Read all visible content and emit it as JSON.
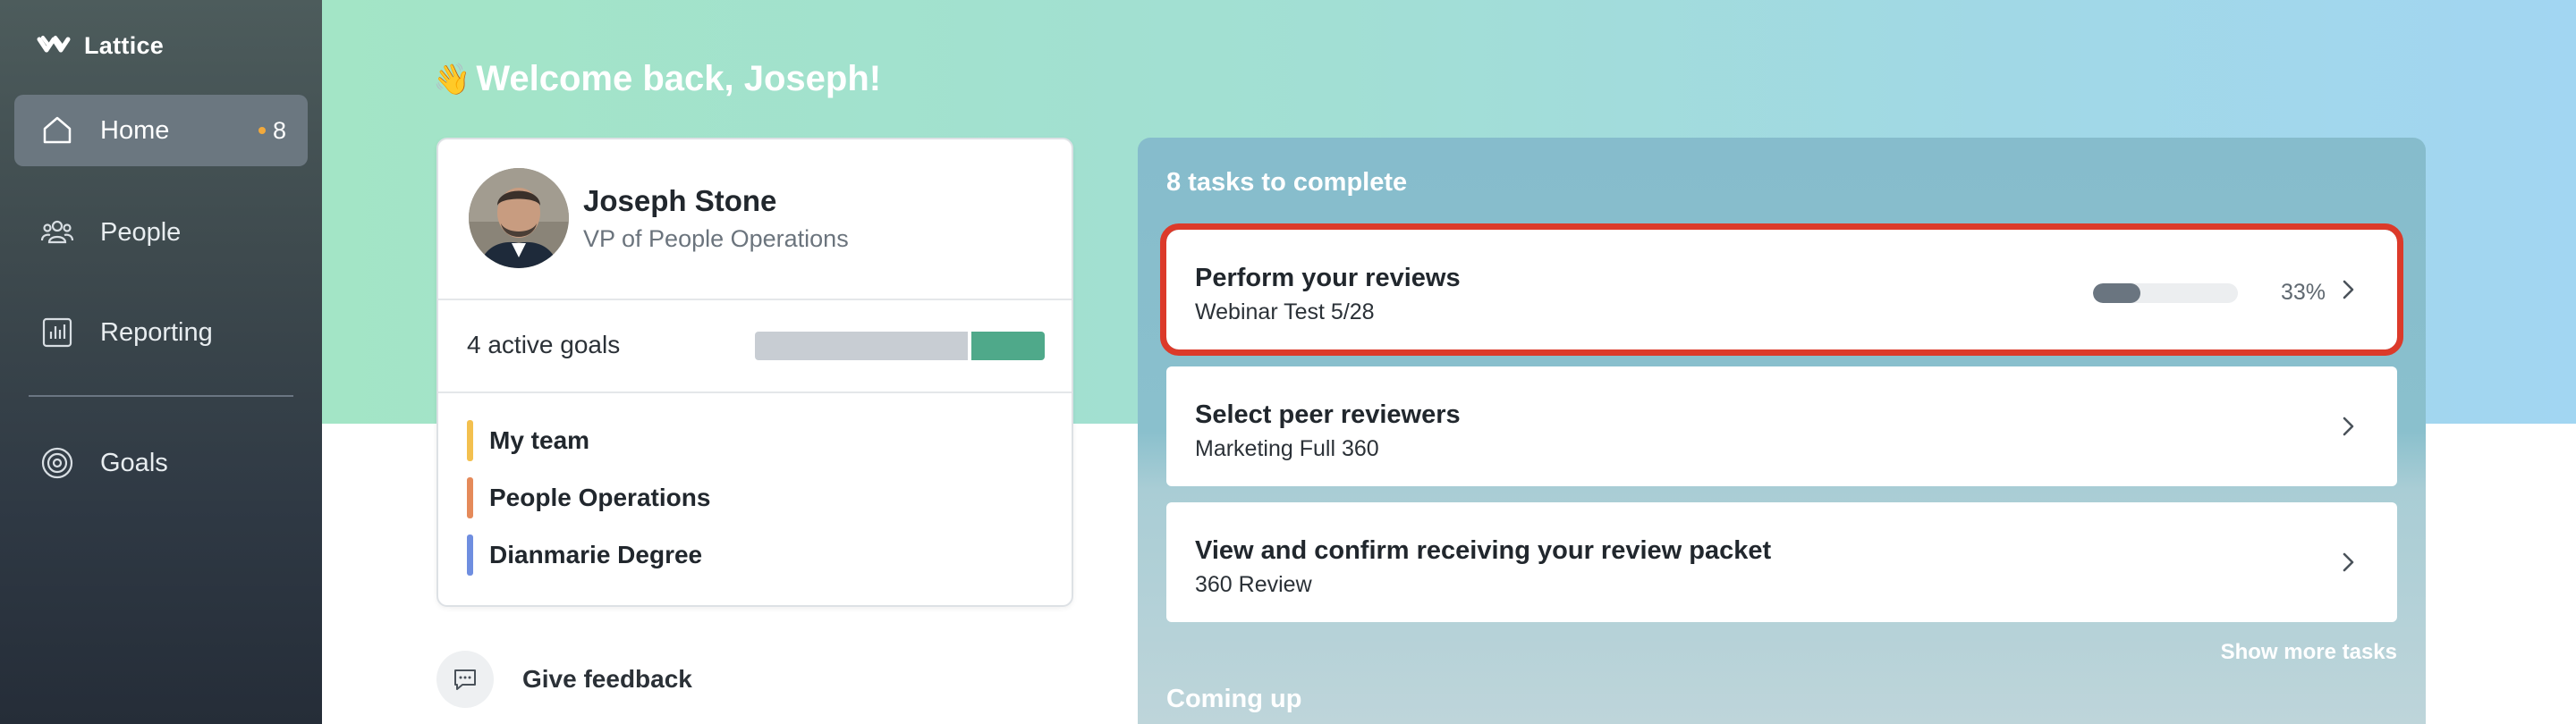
{
  "app": {
    "name": "Lattice"
  },
  "sidebar": {
    "items": [
      {
        "label": "Home",
        "icon": "home-icon",
        "active": true,
        "badge": "8"
      },
      {
        "label": "People",
        "icon": "people-icon",
        "active": false
      },
      {
        "label": "Reporting",
        "icon": "reporting-icon",
        "active": false
      },
      {
        "label": "Goals",
        "icon": "goals-icon",
        "active": false
      }
    ]
  },
  "header": {
    "wave": "👋",
    "welcome": "Welcome back, Joseph!"
  },
  "profile": {
    "name": "Joseph Stone",
    "title": "VP of People Operations",
    "active_goals": "4 active goals",
    "goal_progress_fraction": 0.25,
    "goals": [
      {
        "label": "My team",
        "color": "#f3c04f"
      },
      {
        "label": "People Operations",
        "color": "#e58a5a"
      },
      {
        "label": "Dianmarie Degree",
        "color": "#6f8ee0"
      }
    ]
  },
  "feedback": {
    "label": "Give feedback",
    "icon": "chat-bubble-icon"
  },
  "tasks": {
    "heading": "8 tasks to complete",
    "items": [
      {
        "title": "Perform your reviews",
        "subtitle": "Webinar Test 5/28",
        "progress": 0.33,
        "progress_label": "33%",
        "highlighted": true
      },
      {
        "title": "Select peer reviewers",
        "subtitle": "Marketing Full 360"
      },
      {
        "title": "View and confirm receiving your review packet",
        "subtitle": "360 Review"
      }
    ],
    "show_more": "Show more tasks",
    "coming_up": "Coming up"
  },
  "colors": {
    "accent_green": "#4fa98a",
    "highlight_red": "#dc3a2a",
    "badge_dot": "#f2a93b"
  }
}
